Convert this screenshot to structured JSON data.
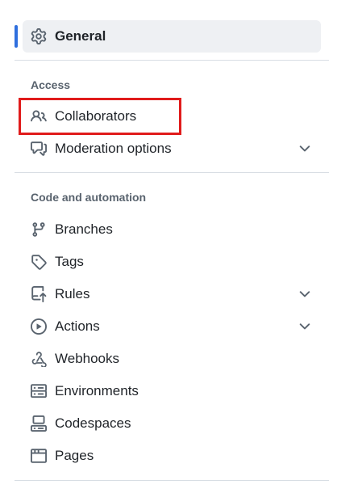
{
  "nav": {
    "general": {
      "label": "General",
      "icon": "gear-icon"
    },
    "access": {
      "title": "Access",
      "items": [
        {
          "label": "Collaborators",
          "icon": "people-icon",
          "expandable": false,
          "highlighted": true
        },
        {
          "label": "Moderation options",
          "icon": "comment-discussion-icon",
          "expandable": true
        }
      ]
    },
    "code_automation": {
      "title": "Code and automation",
      "items": [
        {
          "label": "Branches",
          "icon": "git-branch-icon",
          "expandable": false
        },
        {
          "label": "Tags",
          "icon": "tag-icon",
          "expandable": false
        },
        {
          "label": "Rules",
          "icon": "repo-push-icon",
          "expandable": true
        },
        {
          "label": "Actions",
          "icon": "play-icon",
          "expandable": true
        },
        {
          "label": "Webhooks",
          "icon": "webhook-icon",
          "expandable": false
        },
        {
          "label": "Environments",
          "icon": "server-icon",
          "expandable": false
        },
        {
          "label": "Codespaces",
          "icon": "codespaces-icon",
          "expandable": false
        },
        {
          "label": "Pages",
          "icon": "browser-icon",
          "expandable": false
        }
      ]
    }
  },
  "colors": {
    "active_indicator": "#2f6fde",
    "active_background": "#eef0f3",
    "highlight_box": "#e01b1b",
    "text": "#1f2328",
    "muted": "#59636e",
    "divider": "#d8dee4"
  }
}
